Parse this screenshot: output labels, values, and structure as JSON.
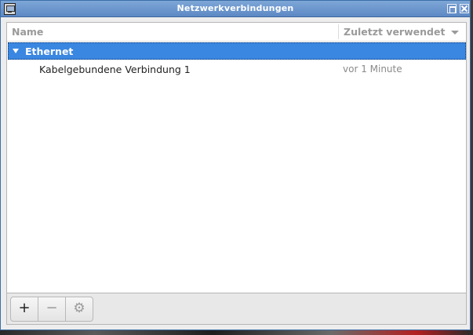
{
  "window": {
    "title": "Netzwerkverbindungen"
  },
  "tree": {
    "columns": {
      "name": "Name",
      "last_used": "Zuletzt verwendet"
    },
    "groups": [
      {
        "label": "Ethernet",
        "expanded": true,
        "selected": true,
        "connections": [
          {
            "name": "Kabelgebundene Verbindung 1",
            "last_used": "vor 1 Minute"
          }
        ]
      }
    ]
  },
  "toolbar": {
    "add_label": "+",
    "remove_label": "−",
    "settings_label": "⚙"
  },
  "colors": {
    "titlebar": "#5c88c4",
    "selection": "#3a87e1"
  }
}
